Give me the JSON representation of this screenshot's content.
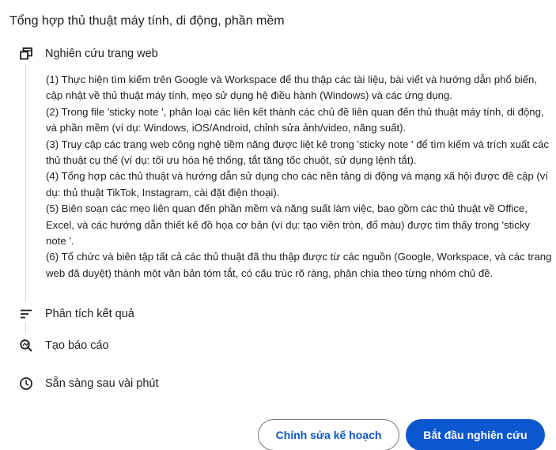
{
  "header": {
    "title": "Tổng hợp thủ thuật máy tính, di động, phần mềm"
  },
  "steps": [
    {
      "label": "Nghiên cứu trang web",
      "icon": "web-research-icon"
    },
    {
      "label": "Phân tích kết quả",
      "icon": "analyze-results-icon"
    },
    {
      "label": "Tạo báo cáo",
      "icon": "create-report-icon"
    },
    {
      "label": "Sẵn sàng sau vài phút",
      "icon": "clock-icon"
    }
  ],
  "plan": {
    "items": [
      "(1) Thực hiện tìm kiếm trên Google và Workspace để thu thập các tài liệu, bài viết và hướng dẫn phổ biến, cập nhật về thủ thuật máy tính, mẹo sử dụng hệ điều hành (Windows) và các ứng dụng.",
      "(2) Trong file 'sticky note ', phân loại các liên kết thành các chủ đề liên quan đến thủ thuật máy tính, di động, và phần mềm (ví dụ: Windows, iOS/Android, chỉnh sửa ảnh/video, năng suất).",
      "(3) Truy cập các trang web công nghệ tiềm năng được liệt kê trong 'sticky note ' để tìm kiếm và trích xuất các thủ thuật cụ thể (ví dụ: tối ưu hóa hệ thống, tắt tăng tốc chuột, sử dụng lệnh tắt).",
      "(4) Tổng hợp các thủ thuật và hướng dẫn sử dụng cho các nền tảng di động và mạng xã hội được đề cập (ví dụ: thủ thuật TikTok, Instagram, cài đặt điện thoại).",
      "(5) Biên soạn các mẹo liên quan đến phần mềm và năng suất làm việc, bao gồm các thủ thuật về Office, Excel, và các hướng dẫn thiết kế đồ họa cơ bản (ví dụ: tạo viền tròn, đổ màu) được tìm thấy trong 'sticky note '.",
      "(6) Tổ chức và biên tập tất cả các thủ thuật đã thu thập được từ các nguồn (Google, Workspace, và các trang web đã duyệt) thành một văn bản tóm tắt, có cấu trúc rõ ràng, phân chia theo từng nhóm chủ đề."
    ]
  },
  "actions": {
    "edit_label": "Chỉnh sửa kế hoạch",
    "start_label": "Bắt đầu nghiên cứu"
  },
  "colors": {
    "accent": "#0b57d0",
    "text": "#1f1f1f",
    "timeline": "#dadce0"
  }
}
